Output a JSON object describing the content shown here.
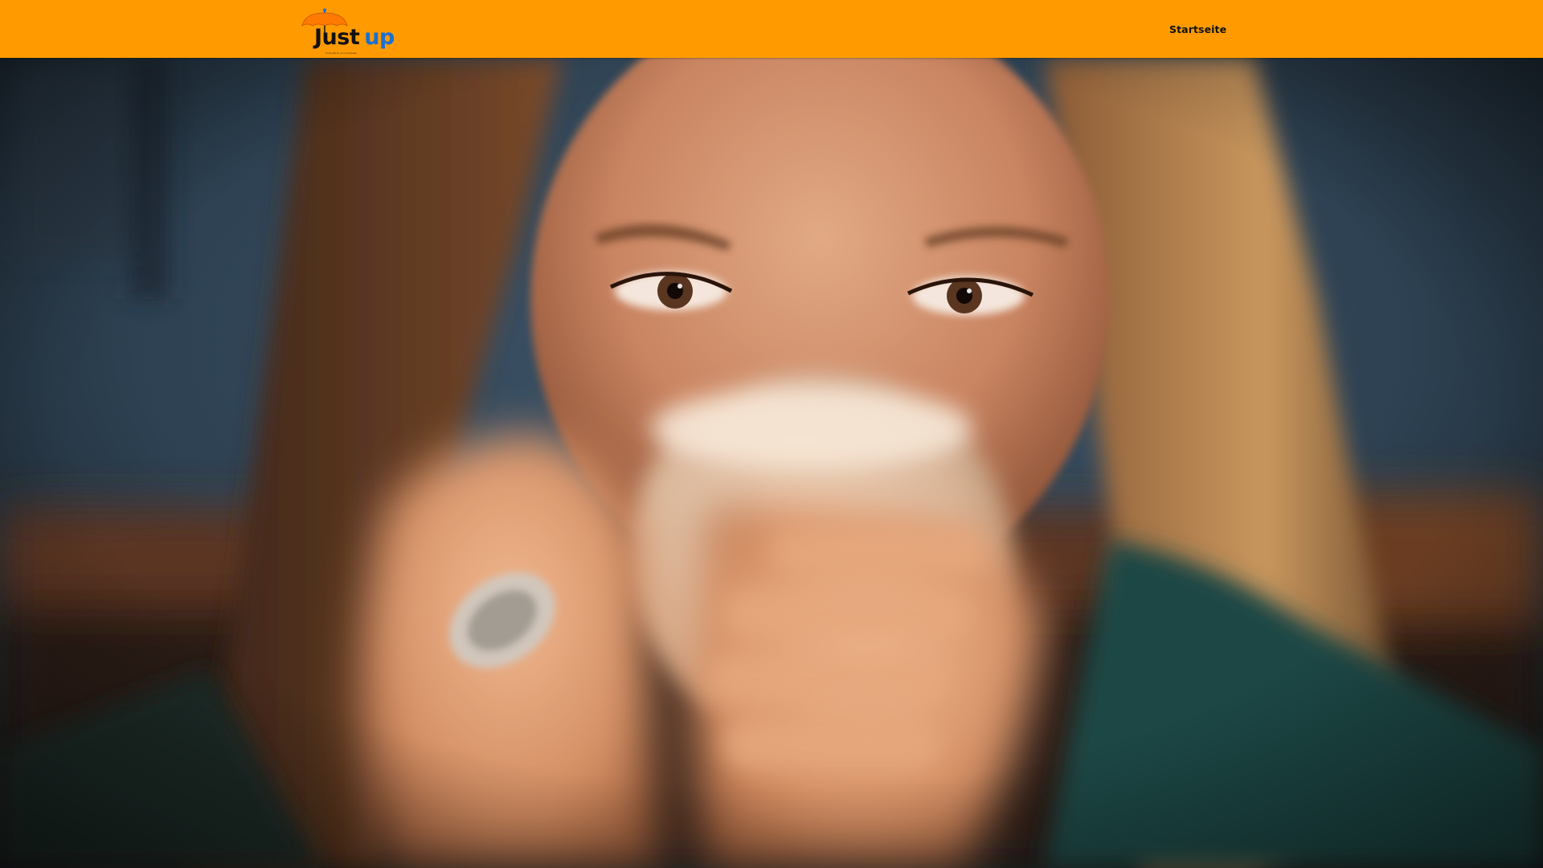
{
  "header": {
    "background_color": "#ff9b00",
    "logo": {
      "word_just": "Just",
      "word_up": "up",
      "tagline": "bring life to your business",
      "icon": "umbrella-icon",
      "colors": {
        "just": "#111111",
        "up": "#1b6fd4",
        "umbrella": "#ff7a00"
      }
    },
    "nav": {
      "items": [
        {
          "label": "Startseite"
        }
      ]
    }
  },
  "hero": {
    "image_description_icon": "photo-woman-drinking-coffee"
  }
}
